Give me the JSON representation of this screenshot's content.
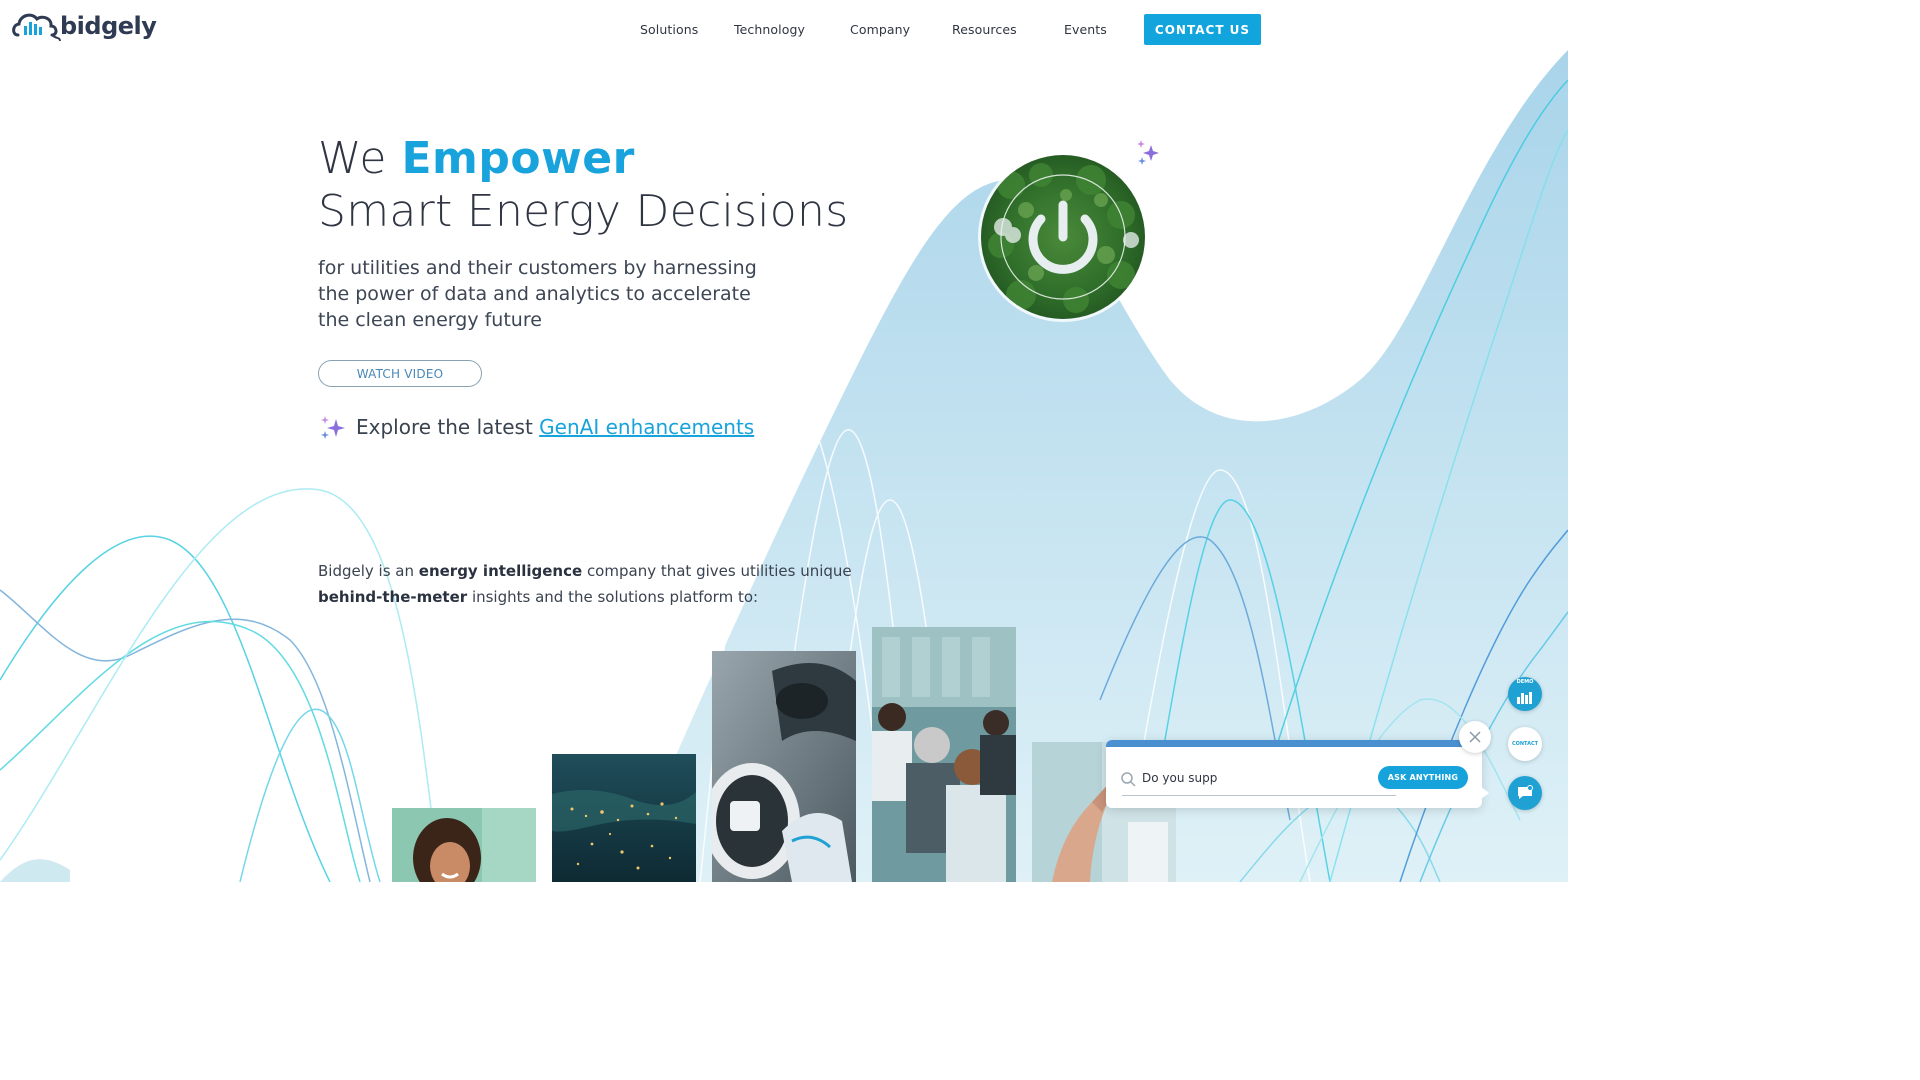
{
  "brand": {
    "name": "bidgely",
    "accent": "#18a3dc",
    "text_color": "#2f3542"
  },
  "nav": {
    "items": [
      {
        "label": "Solutions"
      },
      {
        "label": "Technology"
      },
      {
        "label": "Company"
      },
      {
        "label": "Resources"
      },
      {
        "label": "Events"
      }
    ],
    "contact_label": "CONTACT US"
  },
  "hero": {
    "title_prefix": "We ",
    "title_emphasis": "Empower",
    "title_line2": "Smart Energy Decisions",
    "subtitle": "for utilities and their customers by harnessing the power of data and analytics to accelerate the clean energy future",
    "watch_video_label": "WATCH VIDEO",
    "genai_prefix": "Explore the latest ",
    "genai_link": "GenAI enhancements"
  },
  "intro": {
    "p1": "Bidgely is an ",
    "b1": "energy intelligence",
    "p2": " company that gives utilities unique ",
    "b2": "behind-the-meter",
    "p3": " insights and the solutions platform to:"
  },
  "floating": {
    "demo_label": "DEMO",
    "contact_label": "CONTACT"
  },
  "chat": {
    "input_value": "Do you supp",
    "ask_label": "ASK ANYTHING"
  },
  "icons": [
    "bidgely-logo-icon",
    "sparkle-icon",
    "power-icon",
    "search-icon",
    "close-icon",
    "bar-chart-icon",
    "chat-icon"
  ]
}
